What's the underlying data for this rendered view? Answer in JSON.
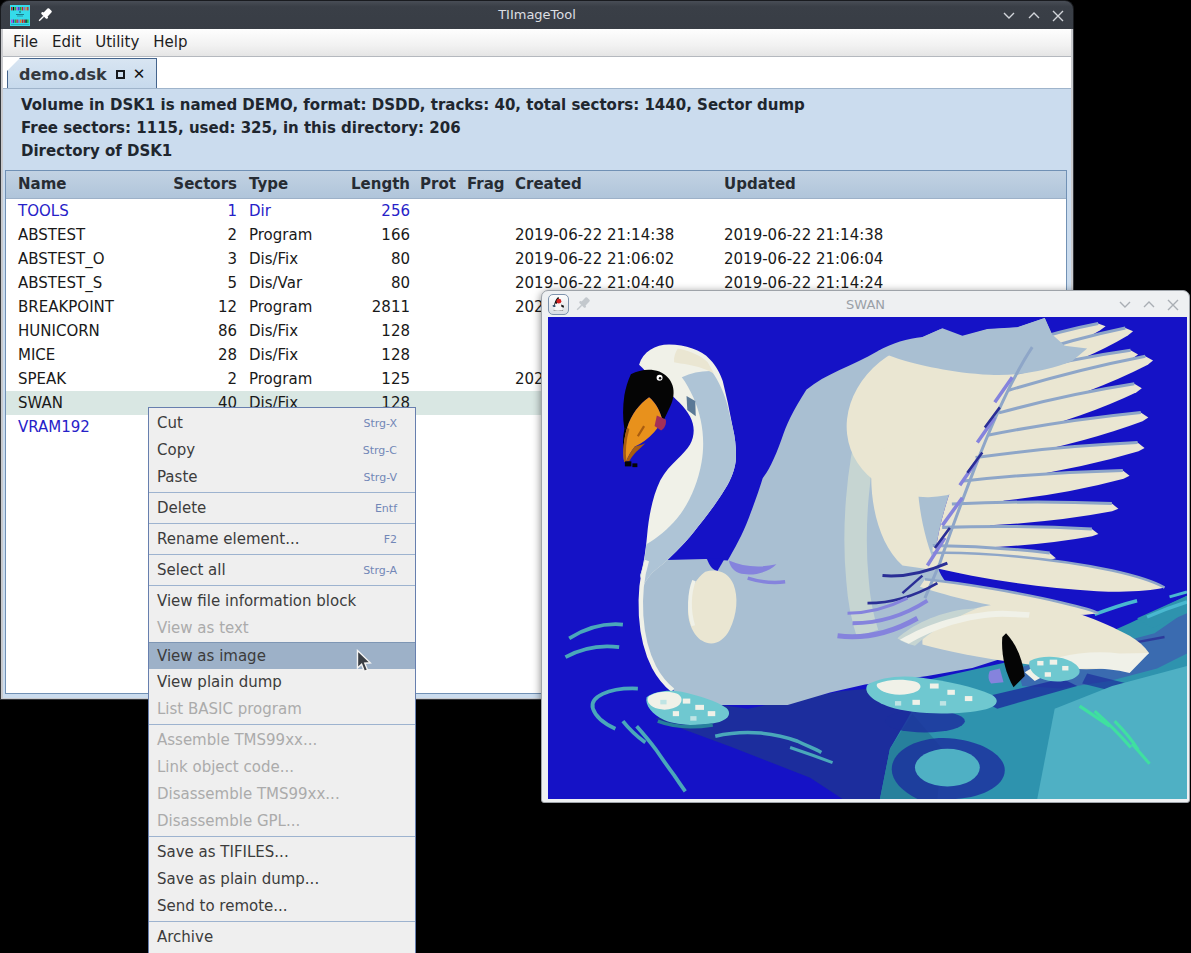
{
  "desktop": {
    "background": "#000000"
  },
  "main_window": {
    "title": "TIImageTool",
    "menu_bar": {
      "items": [
        "File",
        "Edit",
        "Utility",
        "Help"
      ]
    },
    "tab": {
      "label": "demo.dsk"
    },
    "info_lines": [
      "Volume in DSK1 is named DEMO, format: DSDD, tracks: 40, total sectors: 1440, Sector dump",
      "Free sectors: 1115, used: 325, in this directory: 206",
      "Directory of DSK1"
    ],
    "table": {
      "columns": [
        "Name",
        "Sectors",
        "Type",
        "Length",
        "Prot",
        "Frag",
        "Created",
        "Updated"
      ],
      "rows": [
        {
          "name": "TOOLS",
          "sectors": "1",
          "type": "Dir",
          "length": "256",
          "created": "",
          "updated": "",
          "kind": "dir",
          "selected": false
        },
        {
          "name": "ABSTEST",
          "sectors": "2",
          "type": "Program",
          "length": "166",
          "created": "2019-06-22 21:14:38",
          "updated": "2019-06-22 21:14:38",
          "kind": "file",
          "selected": false
        },
        {
          "name": "ABSTEST_O",
          "sectors": "3",
          "type": "Dis/Fix",
          "length": "80",
          "created": "2019-06-22 21:06:02",
          "updated": "2019-06-22 21:06:04",
          "kind": "file",
          "selected": false
        },
        {
          "name": "ABSTEST_S",
          "sectors": "5",
          "type": "Dis/Var",
          "length": "80",
          "created": "2019-06-22 21:04:40",
          "updated": "2019-06-22 21:14:24",
          "kind": "file",
          "selected": false
        },
        {
          "name": "BREAKPOINT",
          "sectors": "12",
          "type": "Program",
          "length": "2811",
          "created": "202",
          "updated": "",
          "kind": "file",
          "selected": false
        },
        {
          "name": "HUNICORN",
          "sectors": "86",
          "type": "Dis/Fix",
          "length": "128",
          "created": "",
          "updated": "",
          "kind": "file",
          "selected": false
        },
        {
          "name": "MICE",
          "sectors": "28",
          "type": "Dis/Fix",
          "length": "128",
          "created": "",
          "updated": "",
          "kind": "file",
          "selected": false
        },
        {
          "name": "SPEAK",
          "sectors": "2",
          "type": "Program",
          "length": "125",
          "created": "202",
          "updated": "",
          "kind": "file",
          "selected": false
        },
        {
          "name": "SWAN",
          "sectors": "40",
          "type": "Dis/Fix",
          "length": "128",
          "created": "",
          "updated": "",
          "kind": "file",
          "selected": true
        },
        {
          "name": "VRAM192",
          "sectors": "",
          "type": "",
          "length": "",
          "created": "",
          "updated": "",
          "kind": "dir",
          "selected": false
        }
      ]
    }
  },
  "context_menu": {
    "groups": [
      [
        {
          "label": "Cut",
          "shortcut": "Strg-X",
          "state": "normal"
        },
        {
          "label": "Copy",
          "shortcut": "Strg-C",
          "state": "normal"
        },
        {
          "label": "Paste",
          "shortcut": "Strg-V",
          "state": "normal"
        }
      ],
      [
        {
          "label": "Delete",
          "shortcut": "Entf",
          "state": "normal"
        }
      ],
      [
        {
          "label": "Rename element...",
          "shortcut": "F2",
          "state": "normal"
        }
      ],
      [
        {
          "label": "Select all",
          "shortcut": "Strg-A",
          "state": "normal"
        }
      ],
      [
        {
          "label": "View file information block",
          "shortcut": "",
          "state": "normal"
        },
        {
          "label": "View as text",
          "shortcut": "",
          "state": "disabled"
        },
        {
          "label": "View as image",
          "shortcut": "",
          "state": "highlight"
        },
        {
          "label": "View plain dump",
          "shortcut": "",
          "state": "normal"
        },
        {
          "label": "List BASIC program",
          "shortcut": "",
          "state": "disabled"
        }
      ],
      [
        {
          "label": "Assemble TMS99xx...",
          "shortcut": "",
          "state": "disabled"
        },
        {
          "label": "Link object code...",
          "shortcut": "",
          "state": "disabled"
        },
        {
          "label": "Disassemble TMS99xx...",
          "shortcut": "",
          "state": "disabled"
        },
        {
          "label": "Disassemble GPL...",
          "shortcut": "",
          "state": "disabled"
        }
      ],
      [
        {
          "label": "Save as TIFILES...",
          "shortcut": "",
          "state": "normal"
        },
        {
          "label": "Save as plain dump...",
          "shortcut": "",
          "state": "normal"
        },
        {
          "label": "Send to remote...",
          "shortcut": "",
          "state": "normal"
        }
      ],
      [
        {
          "label": "Archive",
          "shortcut": "",
          "state": "normal"
        }
      ]
    ]
  },
  "swan_window": {
    "title": "SWAN"
  },
  "icons": {
    "tab_close": "✕",
    "tab_detach": "square-outline",
    "pin": "pushpin",
    "minimize": "chevron-down",
    "maximize": "chevron-up",
    "close": "x-cross"
  },
  "colors": {
    "titlebar": "#383d45",
    "panel_blue": "#cbdcee",
    "header_blue": "#b6c9dd",
    "selection": "#d9e7e3",
    "dir_link": "#2621c8",
    "menu_highlight": "#9db1c8",
    "swan_bg_blue": "#1313c6",
    "water_teal": "#2e93ae"
  }
}
